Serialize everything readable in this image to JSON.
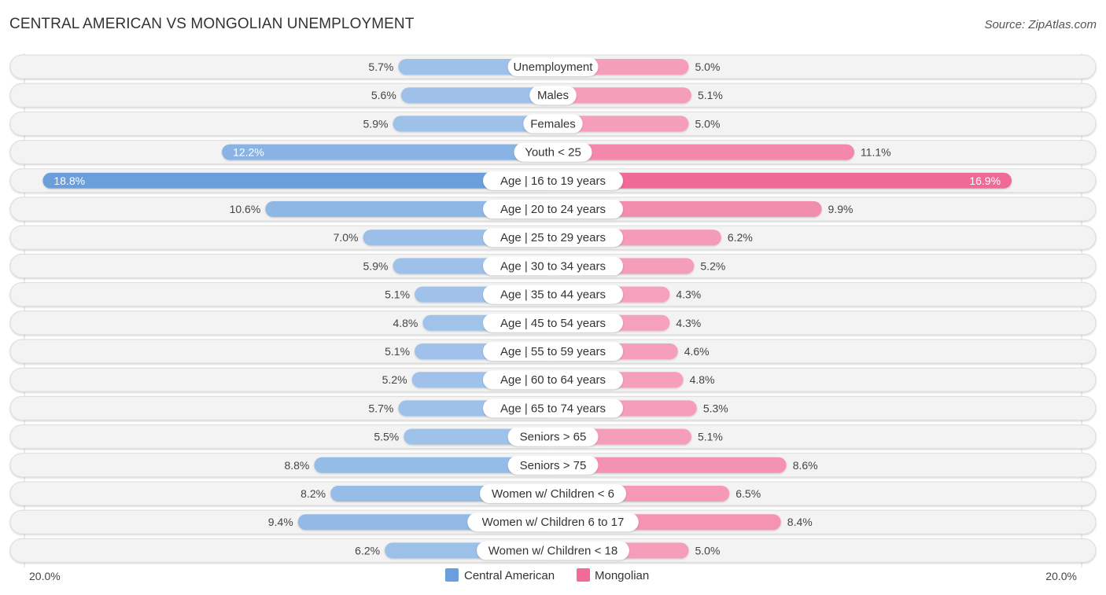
{
  "header": {
    "title": "CENTRAL AMERICAN VS MONGOLIAN UNEMPLOYMENT",
    "source": "Source: ZipAtlas.com"
  },
  "colors": {
    "central_american": "#6a9fdc",
    "central_american_light": "#a9c8ec",
    "mongolian": "#f06b97",
    "mongolian_light": "#f6a8c1"
  },
  "chart_data": {
    "type": "bar",
    "orientation": "horizontal-diverging",
    "title": "CENTRAL AMERICAN VS MONGOLIAN UNEMPLOYMENT",
    "categories": [
      "Unemployment",
      "Males",
      "Females",
      "Youth < 25",
      "Age | 16 to 19 years",
      "Age | 20 to 24 years",
      "Age | 25 to 29 years",
      "Age | 30 to 34 years",
      "Age | 35 to 44 years",
      "Age | 45 to 54 years",
      "Age | 55 to 59 years",
      "Age | 60 to 64 years",
      "Age | 65 to 74 years",
      "Seniors > 65",
      "Seniors > 75",
      "Women w/ Children < 6",
      "Women w/ Children 6 to 17",
      "Women w/ Children < 18"
    ],
    "series": [
      {
        "name": "Central American",
        "side": "left",
        "values": [
          5.7,
          5.6,
          5.9,
          12.2,
          18.8,
          10.6,
          7.0,
          5.9,
          5.1,
          4.8,
          5.1,
          5.2,
          5.7,
          5.5,
          8.8,
          8.2,
          9.4,
          6.2
        ]
      },
      {
        "name": "Mongolian",
        "side": "right",
        "values": [
          5.0,
          5.1,
          5.0,
          11.1,
          16.9,
          9.9,
          6.2,
          5.2,
          4.3,
          4.3,
          4.6,
          4.8,
          5.3,
          5.1,
          8.6,
          6.5,
          8.4,
          5.0
        ]
      }
    ],
    "value_labels": {
      "Central American": [
        "5.7%",
        "5.6%",
        "5.9%",
        "12.2%",
        "18.8%",
        "10.6%",
        "7.0%",
        "5.9%",
        "5.1%",
        "4.8%",
        "5.1%",
        "5.2%",
        "5.7%",
        "5.5%",
        "8.8%",
        "8.2%",
        "9.4%",
        "6.2%"
      ],
      "Mongolian": [
        "5.0%",
        "5.1%",
        "5.0%",
        "11.1%",
        "16.9%",
        "9.9%",
        "6.2%",
        "5.2%",
        "4.3%",
        "4.3%",
        "4.6%",
        "4.8%",
        "5.3%",
        "5.1%",
        "8.6%",
        "6.5%",
        "8.4%",
        "5.0%"
      ]
    },
    "xlim": [
      -20,
      20
    ],
    "axis_labels": {
      "left": "20.0%",
      "right": "20.0%"
    },
    "legend": {
      "position": "bottom-center",
      "entries": [
        "Central American",
        "Mongolian"
      ]
    },
    "grid": false,
    "unit": "%"
  }
}
